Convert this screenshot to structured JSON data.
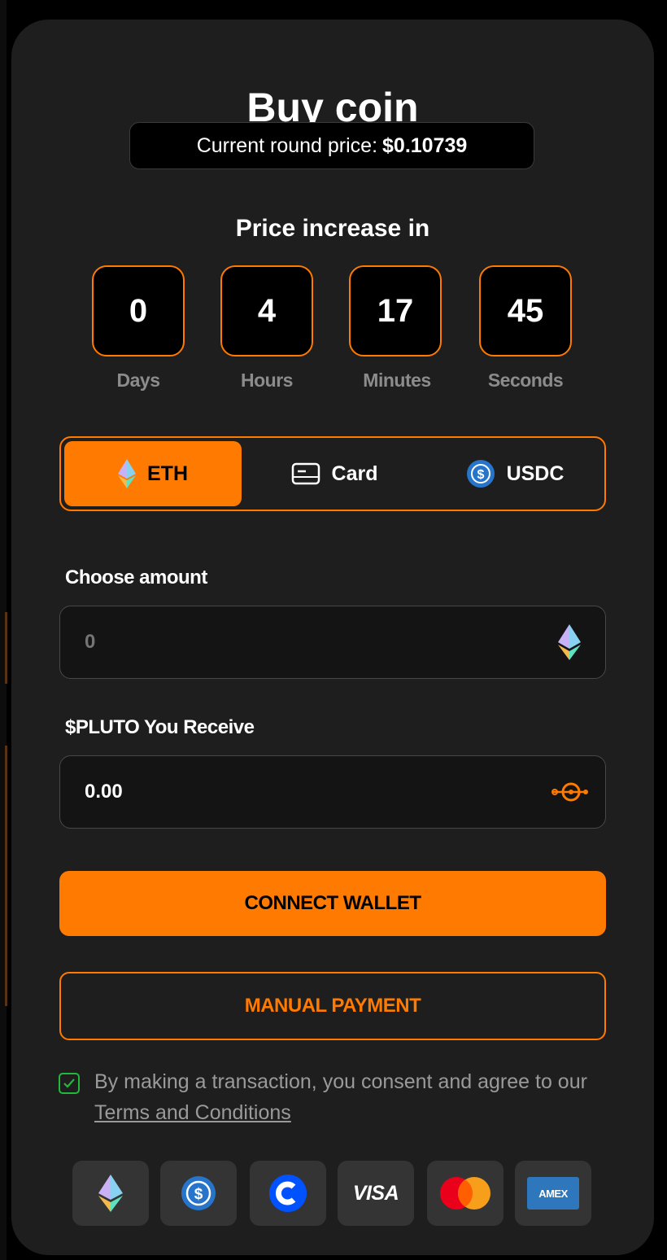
{
  "title": "Buy coin",
  "price": {
    "label": "Current round price:",
    "value": "$0.10739"
  },
  "countdown": {
    "title": "Price increase in",
    "items": [
      {
        "value": "0",
        "label": "Days"
      },
      {
        "value": "4",
        "label": "Hours"
      },
      {
        "value": "17",
        "label": "Minutes"
      },
      {
        "value": "45",
        "label": "Seconds"
      }
    ]
  },
  "tabs": [
    {
      "label": "ETH",
      "icon": "ethereum-icon",
      "active": true
    },
    {
      "label": "Card",
      "icon": "card-icon",
      "active": false
    },
    {
      "label": "USDC",
      "icon": "usdc-icon",
      "active": false
    }
  ],
  "amount": {
    "label": "Choose amount",
    "placeholder": "0",
    "value": ""
  },
  "receive": {
    "label": "$PLUTO You Receive",
    "value": "0.00"
  },
  "buttons": {
    "connect": "CONNECT WALLET",
    "manual": "MANUAL PAYMENT"
  },
  "consent": {
    "text": "By making a transaction, you consent and agree to our ",
    "link": "Terms and Conditions",
    "checked": true
  },
  "payment_methods": [
    {
      "icon": "ethereum-icon"
    },
    {
      "icon": "usdc-icon"
    },
    {
      "icon": "coinbase-icon"
    },
    {
      "icon": "visa-icon",
      "text": "VISA"
    },
    {
      "icon": "mastercard-icon"
    },
    {
      "icon": "amex-icon",
      "text": "AMEX"
    }
  ],
  "colors": {
    "accent": "#ff7a00",
    "card_bg": "#1e1e1e",
    "check": "#21b83c"
  }
}
